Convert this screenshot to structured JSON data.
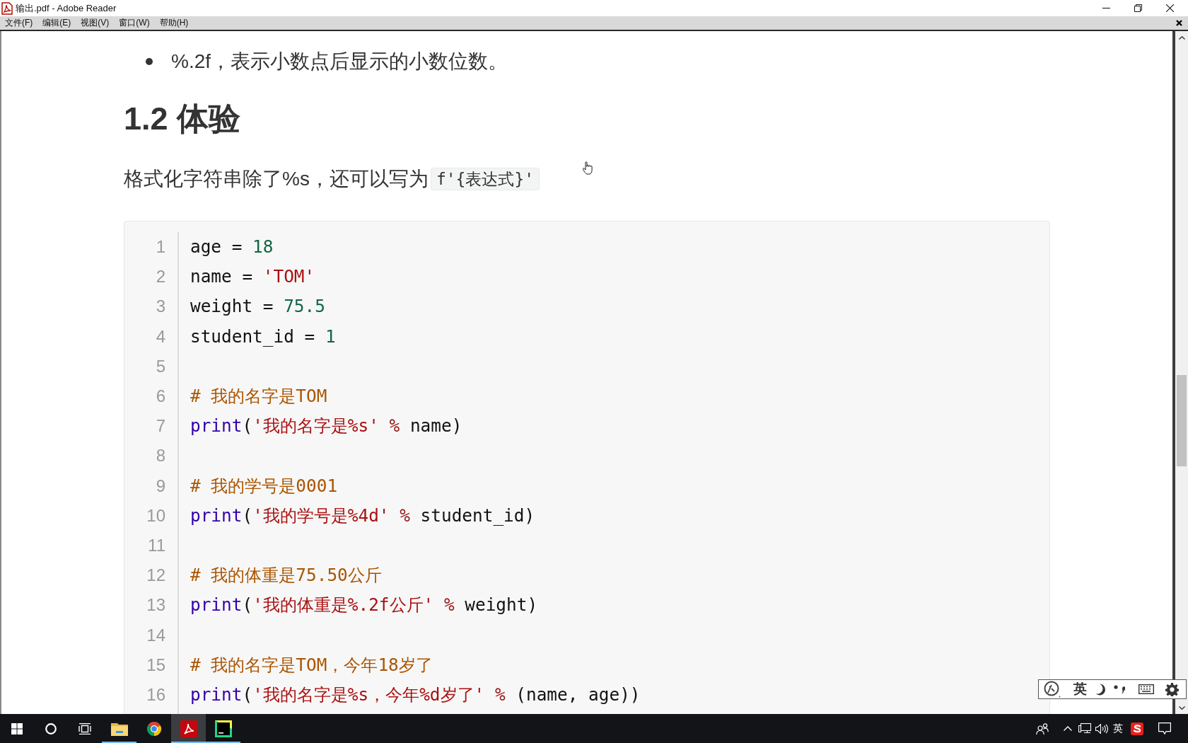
{
  "window": {
    "title": "输出.pdf - Adobe Reader"
  },
  "menu_bar": {
    "items": [
      "文件(F)",
      "编辑(E)",
      "视图(V)",
      "窗口(W)",
      "帮助(H)"
    ]
  },
  "document": {
    "bullets": [
      "%.2f，表示小数点后显示的小数位数。"
    ],
    "heading": "1.2 体验",
    "paragraph": {
      "text": "格式化字符串除了%s，还可以写为",
      "code": "f'{表达式}'"
    },
    "code_block": {
      "lines": [
        {
          "number": "1",
          "tokens": [
            {
              "kind": "plain",
              "text": "age = "
            },
            {
              "kind": "number",
              "text": "18"
            }
          ]
        },
        {
          "number": "2",
          "tokens": [
            {
              "kind": "plain",
              "text": "name = "
            },
            {
              "kind": "string",
              "text": "'TOM'"
            }
          ]
        },
        {
          "number": "3",
          "tokens": [
            {
              "kind": "plain",
              "text": "weight = "
            },
            {
              "kind": "number",
              "text": "75.5"
            }
          ]
        },
        {
          "number": "4",
          "tokens": [
            {
              "kind": "plain",
              "text": "student_id = "
            },
            {
              "kind": "number",
              "text": "1"
            }
          ]
        },
        {
          "number": "5"
        },
        {
          "number": "6",
          "tokens": [
            {
              "kind": "comment",
              "text": "# 我的名字是TOM"
            }
          ]
        },
        {
          "number": "7",
          "tokens": [
            {
              "kind": "builtin",
              "text": "print"
            },
            {
              "kind": "plain",
              "text": "("
            },
            {
              "kind": "string",
              "text": "'我的名字是%s'"
            },
            {
              "kind": "operator",
              "text": " %"
            },
            {
              "kind": "plain",
              "text": " name)"
            }
          ]
        },
        {
          "number": "8"
        },
        {
          "number": "9",
          "tokens": [
            {
              "kind": "comment",
              "text": "# 我的学号是0001"
            }
          ]
        },
        {
          "number": "10",
          "tokens": [
            {
              "kind": "builtin",
              "text": "print"
            },
            {
              "kind": "plain",
              "text": "("
            },
            {
              "kind": "string",
              "text": "'我的学号是%4d'"
            },
            {
              "kind": "operator",
              "text": " %"
            },
            {
              "kind": "plain",
              "text": " student_id)"
            }
          ]
        },
        {
          "number": "11"
        },
        {
          "number": "12",
          "tokens": [
            {
              "kind": "comment",
              "text": "# 我的体重是75.50公斤"
            }
          ]
        },
        {
          "number": "13",
          "tokens": [
            {
              "kind": "builtin",
              "text": "print"
            },
            {
              "kind": "plain",
              "text": "("
            },
            {
              "kind": "string",
              "text": "'我的体重是%.2f公斤'"
            },
            {
              "kind": "operator",
              "text": " %"
            },
            {
              "kind": "plain",
              "text": " weight)"
            }
          ]
        },
        {
          "number": "14"
        },
        {
          "number": "15",
          "tokens": [
            {
              "kind": "comment",
              "text": "# 我的名字是TOM，今年18岁了"
            }
          ]
        },
        {
          "number": "16",
          "tokens": [
            {
              "kind": "builtin",
              "text": "print"
            },
            {
              "kind": "plain",
              "text": "("
            },
            {
              "kind": "string",
              "text": "'我的名字是%s，今年%d岁了'"
            },
            {
              "kind": "operator",
              "text": " %"
            },
            {
              "kind": "plain",
              "text": " (name, age))"
            }
          ]
        }
      ]
    }
  },
  "ime_toolbar": {
    "mode": "英"
  },
  "taskbar": {
    "apps": [
      {
        "kind": "folder",
        "running": true,
        "selected": false
      },
      {
        "kind": "browser",
        "running": false,
        "selected": false
      },
      {
        "kind": "pdf",
        "running": true,
        "selected": true
      },
      {
        "kind": "ide",
        "running": true,
        "selected": false
      }
    ],
    "tray": {
      "input_language": "英"
    }
  }
}
